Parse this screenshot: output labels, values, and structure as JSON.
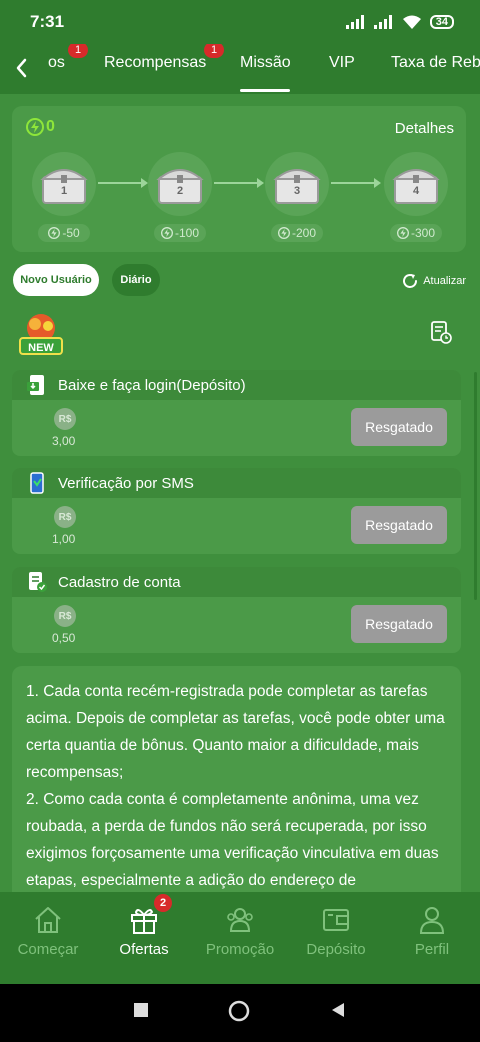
{
  "status_bar": {
    "time": "7:31",
    "battery": "34"
  },
  "tabs": [
    {
      "label": "os",
      "badge": "1"
    },
    {
      "label": "Recompensas",
      "badge": "1"
    },
    {
      "label": "Missão",
      "badge": ""
    },
    {
      "label": "VIP",
      "badge": ""
    },
    {
      "label": "Taxa de Reba",
      "badge": ""
    }
  ],
  "active_tab": "Missão",
  "chest_panel": {
    "energy": "0",
    "details_label": "Detalhes",
    "chests": [
      {
        "num": "1",
        "cost": "-50"
      },
      {
        "num": "2",
        "cost": "-100"
      },
      {
        "num": "3",
        "cost": "-200"
      },
      {
        "num": "4",
        "cost": "-300"
      }
    ]
  },
  "filters": {
    "new_user": "Novo Usuário",
    "daily": "Diário",
    "refresh": "Atualizar"
  },
  "new_badge_text": "NEW",
  "tasks": [
    {
      "title": "Baixe e faça login(Depósito)",
      "currency": "R$",
      "amount": "3,00",
      "button": "Resgatado"
    },
    {
      "title": "Verificação por SMS",
      "currency": "R$",
      "amount": "1,00",
      "button": "Resgatado"
    },
    {
      "title": "Cadastro de conta",
      "currency": "R$",
      "amount": "0,50",
      "button": "Resgatado"
    }
  ],
  "rules": {
    "p1": "1. Cada conta recém-registrada pode completar as tarefas acima. Depois de completar as tarefas, você pode obter uma certa quantia de bônus. Quanto maior a dificuldade, mais recompensas;",
    "p2": "2. Como cada conta é completamente anônima, uma vez roubada, a perda de fundos não será recuperada, por isso exigimos forçosamente uma verificação vinculativa em duas etapas, especialmente a adição do endereço de"
  },
  "bottom_nav": [
    {
      "label": "Começar",
      "icon": "home-icon",
      "badge": ""
    },
    {
      "label": "Ofertas",
      "icon": "gift-icon",
      "badge": "2"
    },
    {
      "label": "Promoção",
      "icon": "people-icon",
      "badge": ""
    },
    {
      "label": "Depósito",
      "icon": "wallet-icon",
      "badge": ""
    },
    {
      "label": "Perfil",
      "icon": "user-icon",
      "badge": ""
    }
  ],
  "active_nav": "Ofertas",
  "colors": {
    "header": "#2f7c2e",
    "page": "#3f8f3d",
    "card": "#4b9a48",
    "energy": "#8ee63a",
    "badge": "#d72a2a",
    "button_disabled": "#9b9b9b"
  }
}
